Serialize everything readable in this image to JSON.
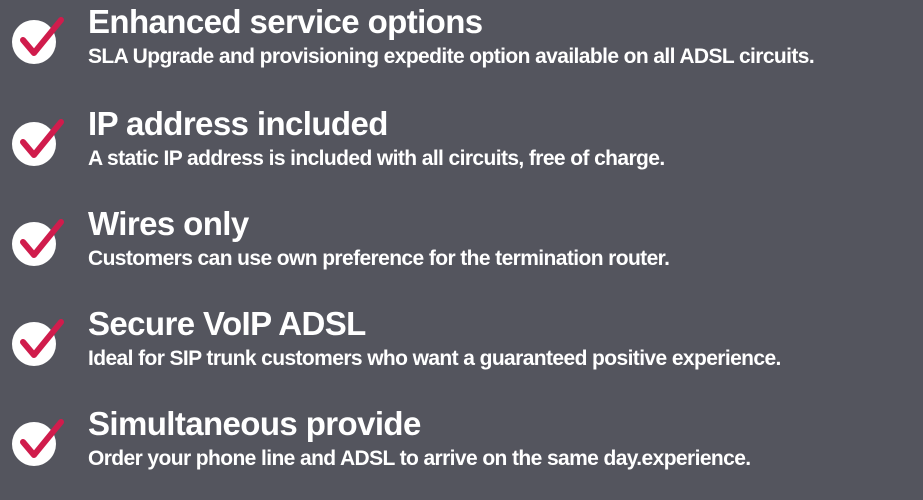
{
  "colors": {
    "background": "#54555e",
    "text": "#ffffff",
    "check_circle": "#ffffff",
    "check_mark": "#d01c4c"
  },
  "features": [
    {
      "icon": "check-circle-icon",
      "title": "Enhanced service options",
      "description": "SLA Upgrade and provisioning expedite option available on all ADSL circuits."
    },
    {
      "icon": "check-circle-icon",
      "title": "IP address included",
      "description": "A static IP address is included with all circuits, free of charge."
    },
    {
      "icon": "check-circle-icon",
      "title": "Wires only",
      "description": "Customers can use own preference for the termination router."
    },
    {
      "icon": "check-circle-icon",
      "title": "Secure VoIP ADSL",
      "description": "Ideal for SIP trunk customers who want a guaranteed positive experience."
    },
    {
      "icon": "check-circle-icon",
      "title": "Simultaneous provide",
      "description": "Order your phone line and ADSL to arrive on the same day.experience."
    }
  ]
}
